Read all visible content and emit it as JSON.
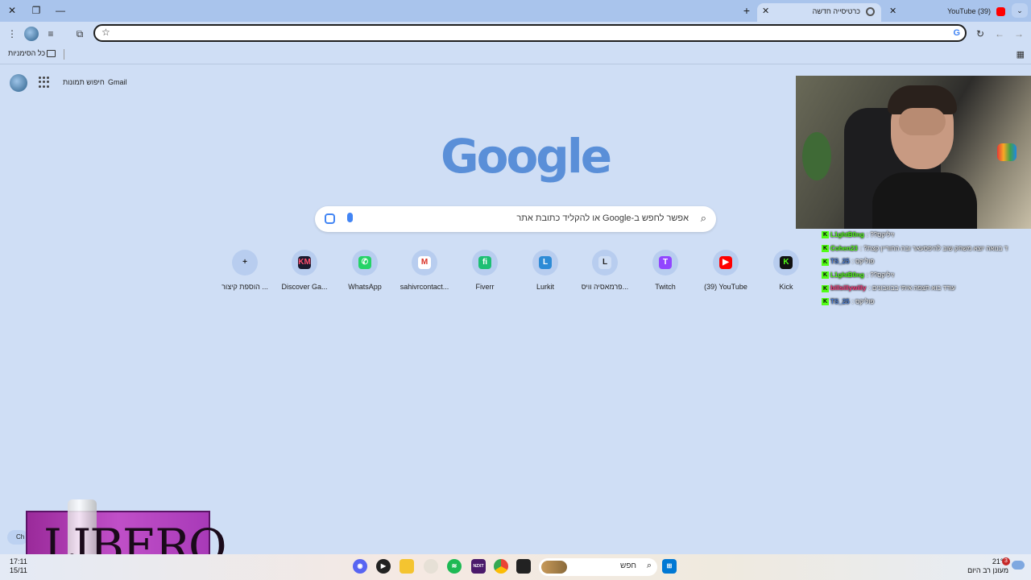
{
  "tabs": [
    {
      "title": "(39) YouTube",
      "icon": "youtube-icon",
      "active": false
    },
    {
      "title": "כרטיסייה חדשה",
      "icon": "chrome-icon",
      "active": true
    }
  ],
  "toolbar": {
    "address_value": ""
  },
  "bookmarks": {
    "all_label": "כל הסימניות"
  },
  "ntp": {
    "gmail": "Gmail",
    "images": "חיפוש תמונות",
    "logo": "Google",
    "search_placeholder": "אפשר לחפש ב-Google או להקליד כתובת אתר",
    "shortcuts": [
      {
        "label": "Kick",
        "color": "#111111",
        "glyph": "K",
        "fg": "#53fc18"
      },
      {
        "label": "(39) YouTube",
        "color": "#ff0000",
        "glyph": "▶",
        "fg": "#ffffff"
      },
      {
        "label": "Twitch",
        "color": "#9146ff",
        "glyph": "T",
        "fg": "#ffffff"
      },
      {
        "label": "פרמאסיה וויס...",
        "color": "#cfdef5",
        "glyph": "L",
        "fg": "#222222"
      },
      {
        "label": "Lurkit",
        "color": "#2d8bd6",
        "glyph": "L",
        "fg": "#ffffff"
      },
      {
        "label": "Fiverr",
        "color": "#1dbf73",
        "glyph": "fi",
        "fg": "#ffffff"
      },
      {
        "label": "sahivrcontact...",
        "color": "#ffffff",
        "glyph": "M",
        "fg": "#d93025"
      },
      {
        "label": "WhatsApp",
        "color": "#25d366",
        "glyph": "✆",
        "fg": "#ffffff"
      },
      {
        "label": "Discover Ga...",
        "color": "#1a1a2e",
        "glyph": "KM",
        "fg": "#ff4d6d"
      },
      {
        "label": "הוספת קיצור ...",
        "color": "#b8cdef",
        "glyph": "+",
        "fg": "#222222"
      }
    ]
  },
  "chat": [
    {
      "user": "L1ghtB0ng",
      "msg": ": ??זיליקס",
      "user_color": "#53fc18"
    },
    {
      "user": "Cohen23",
      "msg": ": ?ד בנואה יוצא משחק שוב להיפסעאר ובה החוריין קצת",
      "user_color": "#53fc18"
    },
    {
      "user": "TS_25",
      "msg": ": פוליקס",
      "user_color": "#4a7bd0"
    },
    {
      "user": "L1ghtB0ng",
      "msg": ": ??זיליקס",
      "user_color": "#53fc18"
    },
    {
      "user": "billsillywilly",
      "msg": ": עודד בוא תצפה איתי בבוגבונים",
      "user_color": "#ff3c7d"
    },
    {
      "user": "TS_25",
      "msg": ": פוליקס",
      "user_color": "#4a7bd0"
    }
  ],
  "overlay": {
    "brand": "LIBERO",
    "chat_button": "Ch"
  },
  "taskbar": {
    "time": "17:11",
    "date": "15/11",
    "search_label": "חפש",
    "weather_temp": "21°C",
    "weather_desc": "מעונן רב היום",
    "notification_count": "3"
  },
  "colors": {
    "page_bg": "#cfdef5",
    "tabbar_bg": "#a9c4ec",
    "accent": "#4285f4"
  }
}
